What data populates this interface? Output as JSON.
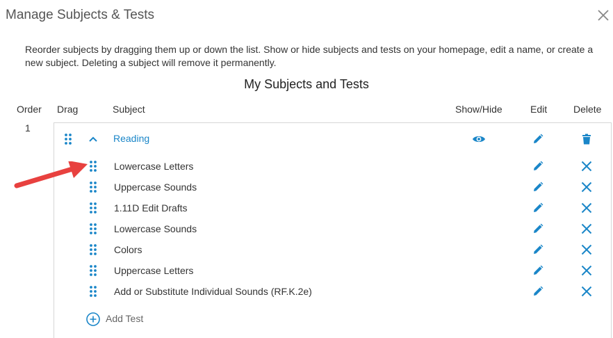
{
  "dialog": {
    "title": "Manage Subjects & Tests",
    "description": "Reorder subjects by dragging them up or down the list. Show or hide subjects and tests on your homepage, edit a name, or create a new subject. Deleting a subject will remove it permanently.",
    "section_title": "My Subjects and Tests"
  },
  "columns": {
    "order": "Order",
    "drag": "Drag",
    "subject": "Subject",
    "show_hide": "Show/Hide",
    "edit": "Edit",
    "delete": "Delete"
  },
  "subject": {
    "order": "1",
    "name": "Reading",
    "tests": [
      "Lowercase Letters",
      "Uppercase Sounds",
      "1.11D Edit Drafts",
      "Lowercase Sounds",
      "Colors",
      "Uppercase Letters",
      "Add or Substitute Individual Sounds (RF.K.2e)"
    ]
  },
  "add_test_label": "Add Test",
  "colors": {
    "accent": "#1a86c8",
    "annotation_arrow": "#e8413f"
  },
  "icons": [
    "close-icon",
    "drag-handle-icon",
    "chevron-up-icon",
    "eye-icon",
    "pencil-icon",
    "trash-icon",
    "x-icon",
    "plus-circle-icon"
  ]
}
